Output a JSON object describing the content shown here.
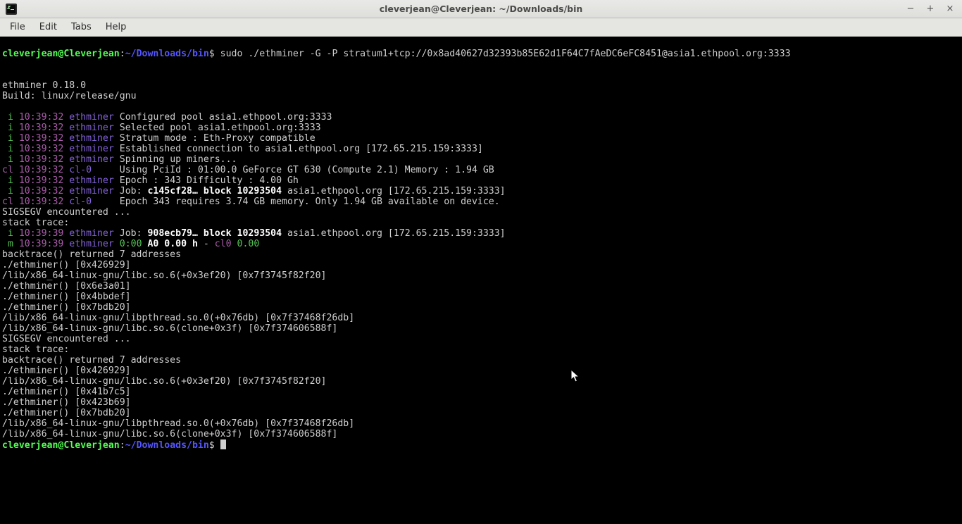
{
  "window": {
    "title": "cleverjean@Cleverjean: ~/Downloads/bin",
    "minimize": "−",
    "maximize": "+",
    "close": "×"
  },
  "menu": {
    "file": "File",
    "edit": "Edit",
    "tabs": "Tabs",
    "help": "Help"
  },
  "prompt": {
    "userhost": "cleverjean@Cleverjean",
    "colon": ":",
    "cwd": "~/Downloads/bin",
    "dollar": "$ ",
    "cmd": "sudo ./ethminer -G -P stratum1+tcp://0x8ad40627d32393b85E62d1F64C7fAeDC6eFC8451@asia1.ethpool.org:3333"
  },
  "body": {
    "blank1": " ",
    "blank2": " ",
    "ver": "ethminer 0.18.0",
    "build": "Build: linux/release/gnu",
    "blank3": " "
  },
  "log": {
    "i": " i ",
    "cl": "cl ",
    "m": " m ",
    "t32": "10:39:32 ",
    "t39": "10:39:39 ",
    "eth": "ethminer",
    "cl0": "cl-0    ",
    "l1": " Configured pool asia1.ethpool.org:3333",
    "l2": " Selected pool asia1.ethpool.org:3333",
    "l3": " Stratum mode : Eth-Proxy compatible",
    "l4": " Established connection to asia1.ethpool.org [172.65.215.159:3333]",
    "l5": " Spinning up miners...",
    "l6": " Using PciId : 01:00.0 GeForce GT 630 (Compute 2.1) Memory : 1.94 GB",
    "l7": " Epoch : 343 Difficulty : 4.00 Gh",
    "l8a": " Job: ",
    "l8b": "c145cf28…",
    "l8c": " block 10293504",
    "l8d": " asia1.ethpool.org [172.65.215.159:3333]",
    "l9": " Epoch 343 requires 3.74 GB memory. Only 1.94 GB available on device.",
    "l10a": " Job: ",
    "l10b": "908ecb79…",
    "l10c": " block 10293504",
    "l10d": " asia1.ethpool.org [172.65.215.159:3333]",
    "l11a": " 0:00 ",
    "l11b": "A0",
    "l11c": " 0.00 h",
    "l11d": " - ",
    "l11e": "cl0",
    "l11f": " 0.00"
  },
  "trace": {
    "sig": "SIGSEGV encountered ...",
    "st": "stack trace:",
    "bt": "backtrace() returned 7 addresses",
    "a1": "./ethminer() [0x426929]",
    "a2": "/lib/x86_64-linux-gnu/libc.so.6(+0x3ef20) [0x7f3745f82f20]",
    "a3": "./ethminer() [0x6e3a01]",
    "a4": "./ethminer() [0x4bbdef]",
    "a5": "./ethminer() [0x7bdb20]",
    "a6": "/lib/x86_64-linux-gnu/libpthread.so.0(+0x76db) [0x7f37468f26db]",
    "a7": "/lib/x86_64-linux-gnu/libc.so.6(clone+0x3f) [0x7f374606588f]",
    "b3": "./ethminer() [0x41b7c5]",
    "b4": "./ethminer() [0x423b69]"
  }
}
